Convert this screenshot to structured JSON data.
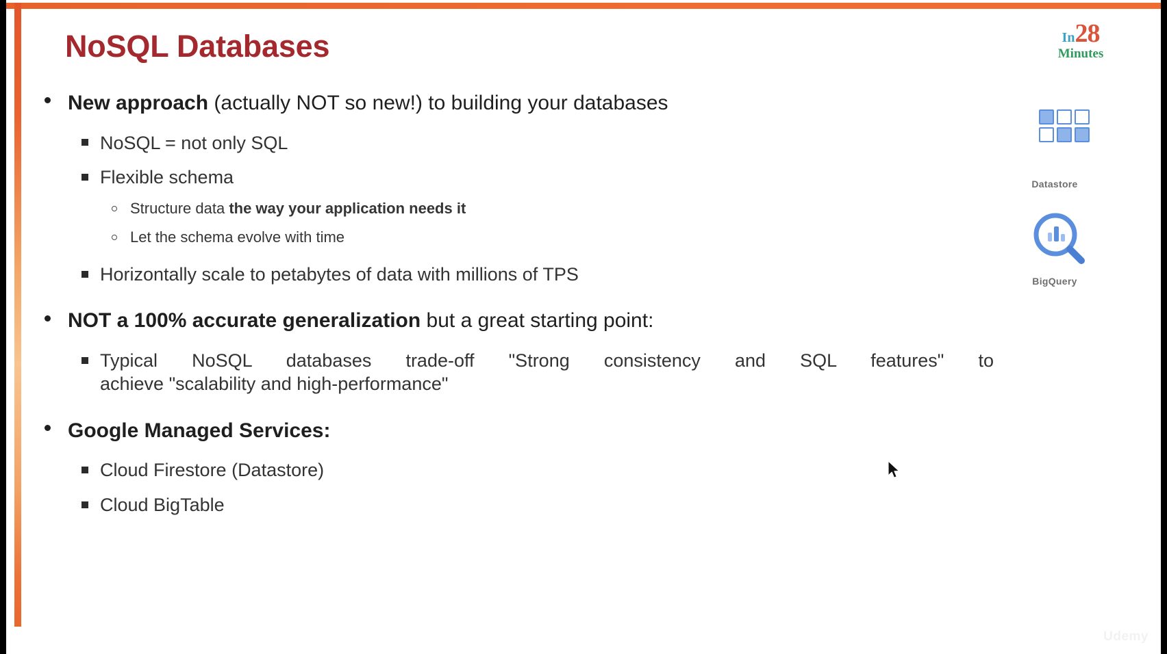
{
  "slide": {
    "title": "NoSQL Databases",
    "title_color": "#a4292f",
    "accent_color": "#ef6b2f",
    "background": "#ffffff"
  },
  "bullets": {
    "b1": {
      "bold": "New approach",
      "rest": " (actually NOT so new!) to building your databases"
    },
    "b1_s1": "NoSQL = not only SQL",
    "b1_s2": "Flexible schema",
    "b1_s2_t1": {
      "normal": "Structure data ",
      "bold": "the way your application needs it"
    },
    "b1_s2_t2": "Let the schema evolve with time",
    "b1_s3": "Horizontally scale to petabytes of data with millions of TPS",
    "b2": {
      "bold": "NOT a 100% accurate generalization",
      "rest": " but a great starting point:"
    },
    "b2_s1_line1": "Typical NoSQL databases trade-off \"Strong consistency and SQL features\" to",
    "b2_s1_line2": "achieve \"scalability and high-performance\"",
    "b3": {
      "bold": "Google Managed Services:"
    },
    "b3_s1": "Cloud Firestore (Datastore)",
    "b3_s2": "Cloud BigTable"
  },
  "rail": {
    "logo": {
      "in": "In",
      "number": "28",
      "minutes": "Minutes",
      "in_color": "#3aa3c4",
      "number_color": "#d9543a",
      "minutes_color": "#2e9b5c"
    },
    "datastore_label": "Datastore",
    "bigquery_label": "BigQuery",
    "icon_color": "#5b8fdd"
  },
  "watermark": "Udemy"
}
